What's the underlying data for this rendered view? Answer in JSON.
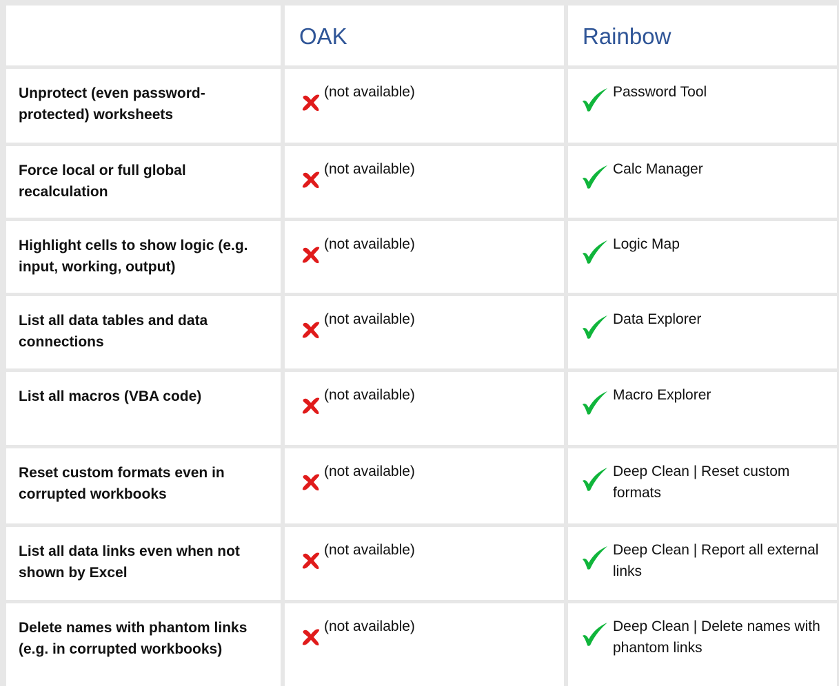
{
  "header": {
    "col_oak": "OAK",
    "col_rainbow": "Rainbow"
  },
  "colors": {
    "header_text": "#2f5597",
    "cross": "#e01b1b",
    "check": "#10b53b",
    "background": "#e7e7e7"
  },
  "icons": {
    "oak_status": "cross-icon",
    "rainbow_status": "checkmark-icon"
  },
  "rows": [
    {
      "feature": "Unprotect (even password-protected) worksheets",
      "oak": "(not available)",
      "rainbow": "Password Tool"
    },
    {
      "feature": "Force local or full global recalculation",
      "oak": "(not available)",
      "rainbow": "Calc Manager"
    },
    {
      "feature": "Highlight cells to show logic (e.g. input, working, output)",
      "oak": "(not available)",
      "rainbow": "Logic Map"
    },
    {
      "feature": "List all data tables and data connections",
      "oak": "(not available)",
      "rainbow": "Data Explorer"
    },
    {
      "feature": "List all macros (VBA code)",
      "oak": "(not available)",
      "rainbow": "Macro Explorer"
    },
    {
      "feature": "Reset custom formats even in corrupted workbooks",
      "oak": "(not available)",
      "rainbow": "Deep Clean | Reset custom formats"
    },
    {
      "feature": "List all data links even when not shown by Excel",
      "oak": "(not available)",
      "rainbow": "Deep Clean | Report all external links"
    },
    {
      "feature": "Delete names with phantom links (e.g. in corrupted workbooks)",
      "oak": "(not available)",
      "rainbow": "Deep Clean | Delete names with phantom links"
    }
  ]
}
